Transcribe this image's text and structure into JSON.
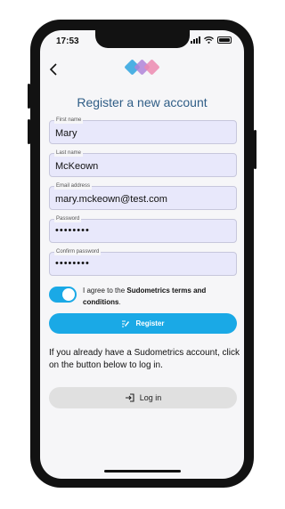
{
  "statusbar": {
    "time": "17:53"
  },
  "header": {
    "back_icon": "chevron-left-icon",
    "logo_colors": [
      "#3aa9e0",
      "#b084d8",
      "#ec8ab0"
    ]
  },
  "page_title": "Register a new account",
  "form": {
    "first_name": {
      "label": "First name",
      "value": "Mary"
    },
    "last_name": {
      "label": "Last name",
      "value": "McKeown"
    },
    "email": {
      "label": "Email address",
      "value": "mary.mckeown@test.com"
    },
    "password": {
      "label": "Password",
      "value": "••••••••"
    },
    "confirm_password": {
      "label": "Confirm password",
      "value": "••••••••"
    }
  },
  "terms": {
    "toggle_on": true,
    "prefix": "I agree to the ",
    "bold": "Sudometrics terms and conditions",
    "suffix": "."
  },
  "register_button": {
    "label": "Register",
    "icon": "form-edit-icon"
  },
  "info_text": "If you already have a Sudometrics account, click on the button below to log in.",
  "login_button": {
    "label": "Log in",
    "icon": "login-icon"
  },
  "colors": {
    "accent": "#1aa9e6",
    "title": "#2f5d86",
    "field_bg": "#e8e8fb"
  }
}
